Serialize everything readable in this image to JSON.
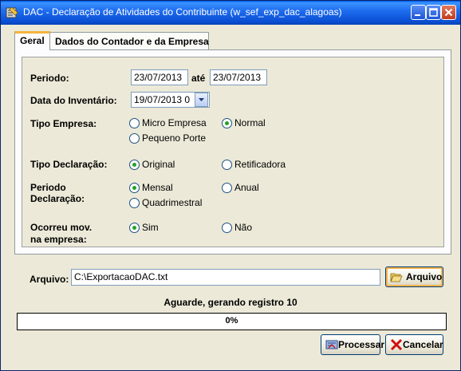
{
  "window": {
    "title": "DAC - Declaração de Atividades do Contribuinte (w_sef_exp_dac_alagoas)"
  },
  "tabs": [
    {
      "label": "Geral",
      "active": true
    },
    {
      "label": "Dados do Contador e da Empresa",
      "active": false
    }
  ],
  "form": {
    "periodo": {
      "label": "Periodo:",
      "start": "23/07/2013",
      "sep": "até",
      "end": "23/07/2013"
    },
    "inventario": {
      "label": "Data do Inventário:",
      "value": "19/07/2013 0"
    },
    "tipo_empresa": {
      "label": "Tipo Empresa:",
      "options": [
        "Micro Empresa",
        "Normal",
        "Pequeno Porte"
      ],
      "selected": "Normal"
    },
    "tipo_declaracao": {
      "label": "Tipo Declaração:",
      "options": [
        "Original",
        "Retificadora"
      ],
      "selected": "Original"
    },
    "periodo_declaracao": {
      "label_line1": "Periodo",
      "label_line2": "Declaração:",
      "options": [
        "Mensal",
        "Anual",
        "Quadrimestral"
      ],
      "selected": "Mensal"
    },
    "ocorreu_mov": {
      "label_line1": "Ocorreu mov.",
      "label_line2": "na empresa:",
      "options": [
        "Sim",
        "Não"
      ],
      "selected": "Sim"
    }
  },
  "arquivo": {
    "label": "Arquivo:",
    "value": "C:\\ExportacaoDAC.txt",
    "button": "Arquivo"
  },
  "status": {
    "message": "Aguarde, gerando registro 10",
    "progress_text": "0%",
    "progress_fraction": 0
  },
  "buttons": {
    "processar": "Processar",
    "cancelar": "Cancelar"
  },
  "colors": {
    "titlebar": "#0a4fd4",
    "face": "#ece9d8",
    "radio_dot": "#21a121",
    "tab_highlight": "#f3b53e"
  },
  "icons": {
    "app": "dac-app-icon",
    "arquivo": "folder-open-icon",
    "processar": "process-icon",
    "cancelar": "red-x-icon"
  }
}
